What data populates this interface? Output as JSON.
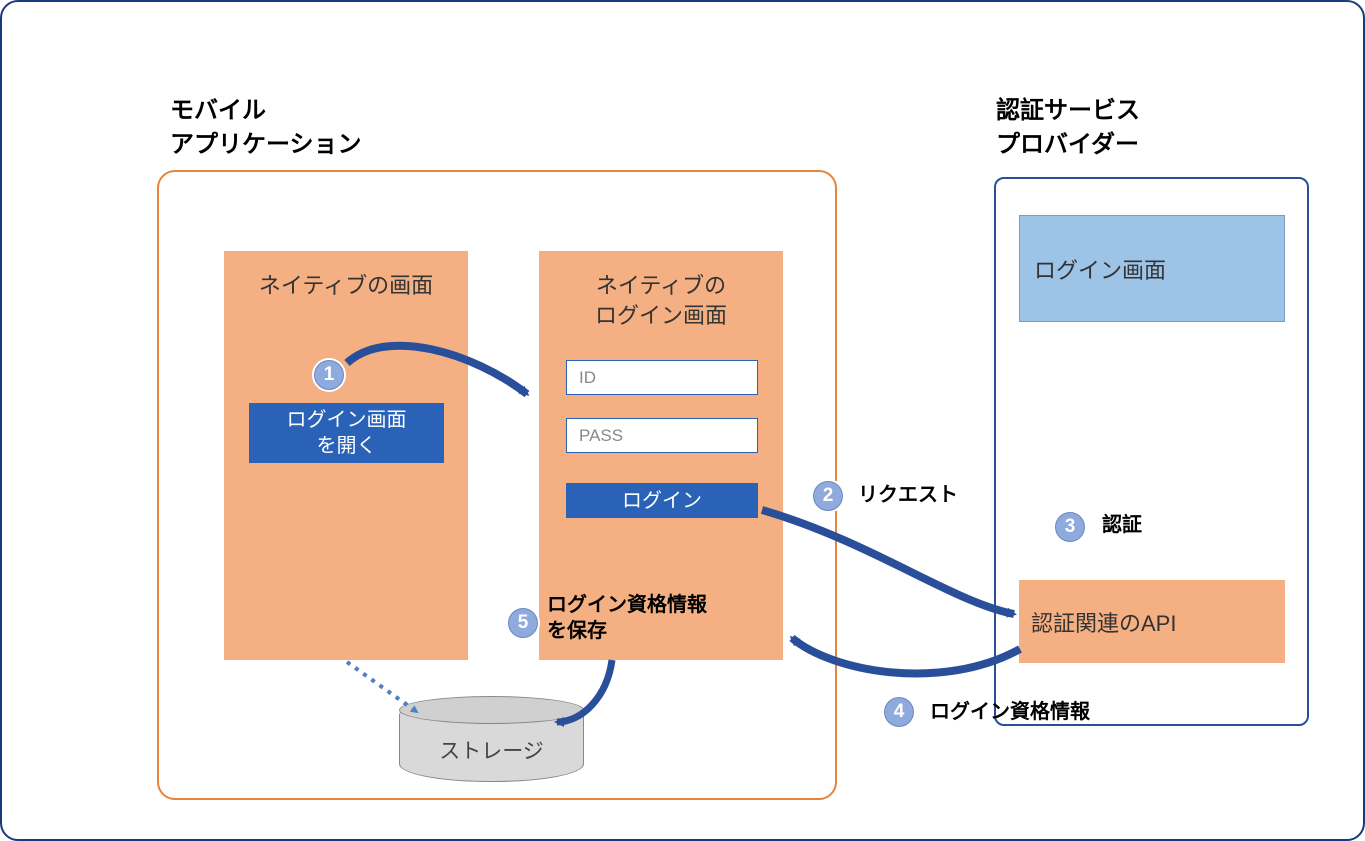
{
  "titles": {
    "mobile_line1": "モバイル",
    "mobile_line2": "アプリケーション",
    "auth_line1": "認証サービス",
    "auth_line2": "プロバイダー"
  },
  "mobile": {
    "native_screen_label": "ネイティブの画面",
    "native_login_label_line1": "ネイティブの",
    "native_login_label_line2": "ログイン画面",
    "open_login_line1": "ログイン画面",
    "open_login_line2": "を開く",
    "id_placeholder": "ID",
    "pass_placeholder": "PASS",
    "login_button": "ログイン"
  },
  "auth": {
    "login_panel": "ログイン画面",
    "api_panel": "認証関連のAPI"
  },
  "storage": {
    "label": "ストレージ"
  },
  "steps": {
    "n1": "1",
    "n2": "2",
    "n3": "3",
    "n4": "4",
    "n5": "5",
    "label2": "リクエスト",
    "label3": "認証",
    "label4": "ログイン資格情報",
    "label5_line1": "ログイン資格情報",
    "label5_line2": "を保存"
  }
}
